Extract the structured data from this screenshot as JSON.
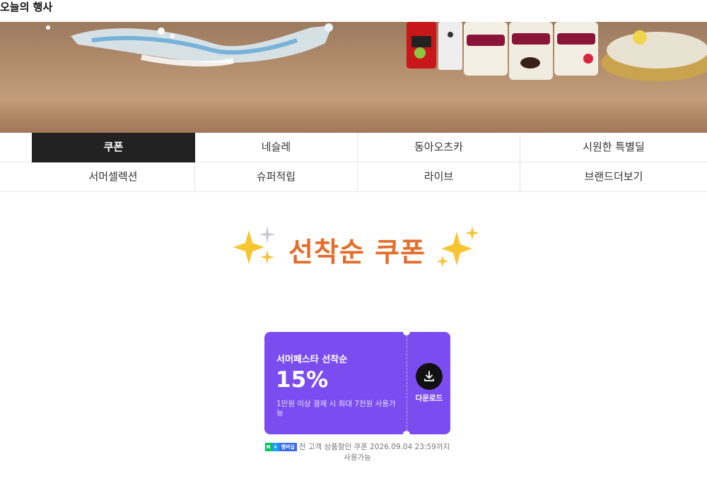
{
  "page": {
    "title": "오늘의 행사"
  },
  "banner": {
    "description_icon": "summer-promo-banner"
  },
  "tabs": {
    "row1": [
      {
        "label": "쿠폰",
        "active": true
      },
      {
        "label": "네슬레",
        "active": false
      },
      {
        "label": "동아오츠카",
        "active": false
      },
      {
        "label": "시원한 특별딜",
        "active": false
      }
    ],
    "row2": [
      {
        "label": "서머셀렉션"
      },
      {
        "label": "슈퍼적립"
      },
      {
        "label": "라이브"
      },
      {
        "label": "브랜드더보기"
      }
    ]
  },
  "section": {
    "heading": "선착순 쿠폰",
    "icon": "sparkles-icon"
  },
  "coupon": {
    "title": "서머페스타 선착순",
    "discount": "15%",
    "condition": "1만원 이상 결제 시 최대 7천원 사용가능",
    "download_label": "다운로드",
    "badge_label": "멤버십",
    "note": "전 고객 상품할인 쿠폰 2026.09.04 23:59까지 사용가능"
  },
  "colors": {
    "accent": "#7b4df0",
    "heading": "#e36d2a",
    "active_tab": "#222222"
  }
}
